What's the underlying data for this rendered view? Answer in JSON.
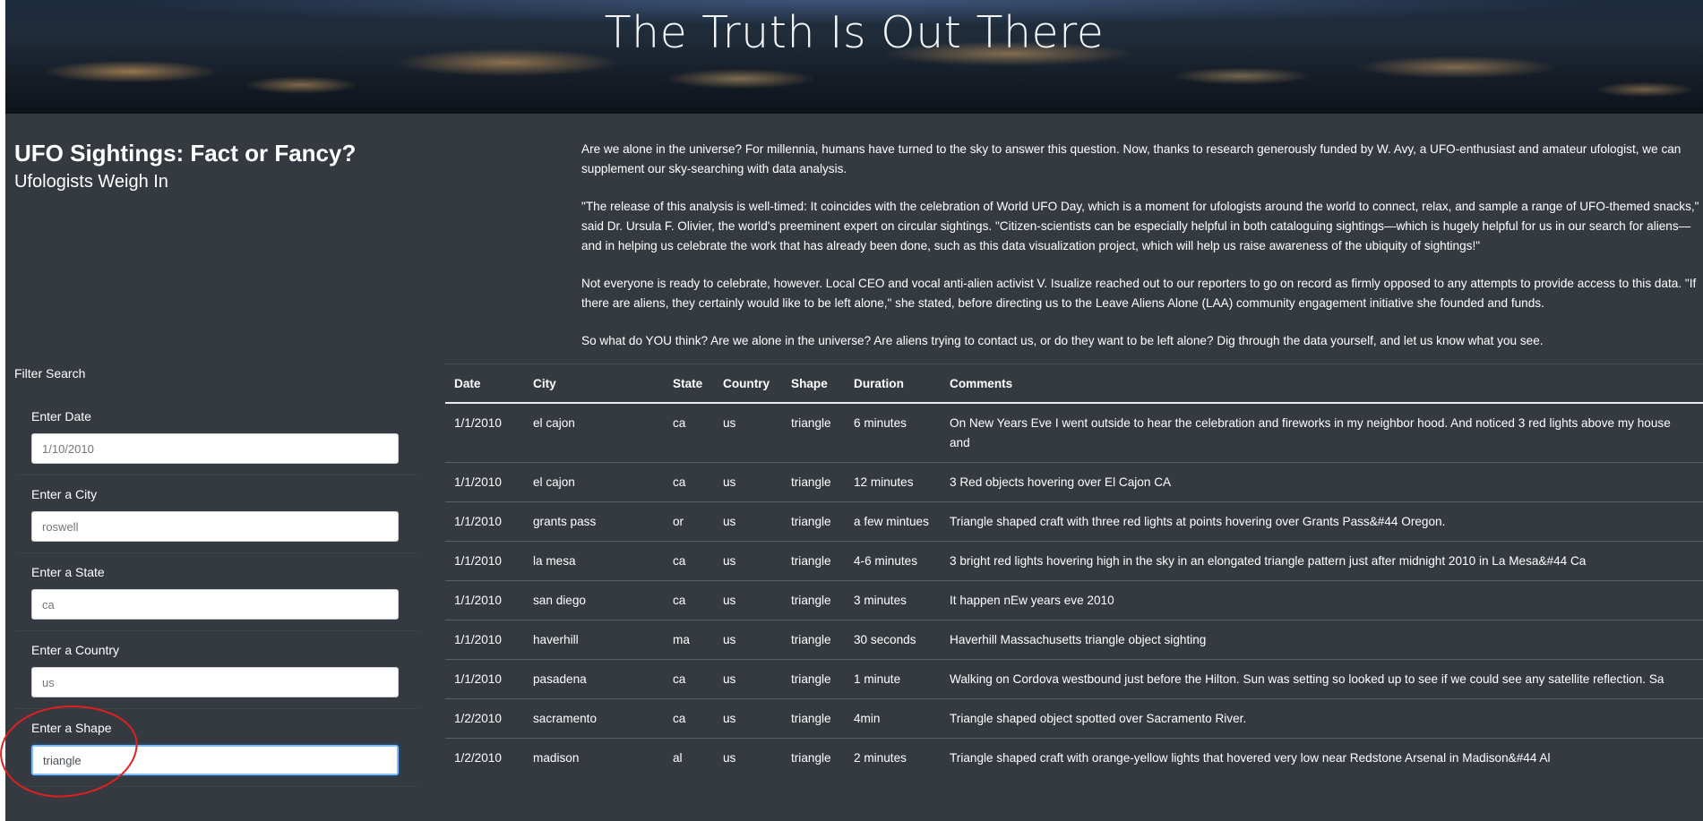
{
  "hero": {
    "title": "The Truth Is Out There"
  },
  "heading": {
    "title": "UFO Sightings: Fact or Fancy?",
    "subtitle": "Ufologists Weigh In"
  },
  "article": {
    "paragraphs": [
      "Are we alone in the universe? For millennia, humans have turned to the sky to answer this question. Now, thanks to research generously funded by W. Avy, a UFO-enthusiast and amateur ufologist, we can supplement our sky-searching with data analysis.",
      "\"The release of this analysis is well-timed: It coincides with the celebration of World UFO Day, which is a moment for ufologists around the world to connect, relax, and sample a range of UFO-themed snacks,\" said Dr. Ursula F. Olivier, the world's preeminent expert on circular sightings. \"Citizen-scientists can be especially helpful in both cataloguing sightings—which is hugely helpful for us in our search for aliens—and in helping us celebrate the work that has already been done, such as this data visualization project, which will help us raise awareness of the ubiquity of sightings!\"",
      "Not everyone is ready to celebrate, however. Local CEO and vocal anti-alien activist V. Isualize reached out to our reporters to go on record as firmly opposed to any attempts to provide access to this data. \"If there are aliens, they certainly would like to be left alone,\" she stated, before directing us to the Leave Aliens Alone (LAA) community engagement initiative she founded and funds.",
      "So what do YOU think? Are we alone in the universe? Are aliens trying to contact us, or do they want to be left alone? Dig through the data yourself, and let us know what you see."
    ]
  },
  "filter": {
    "label": "Filter Search",
    "fields": [
      {
        "label": "Enter Date",
        "placeholder": "1/10/2010",
        "value": ""
      },
      {
        "label": "Enter a City",
        "placeholder": "roswell",
        "value": ""
      },
      {
        "label": "Enter a State",
        "placeholder": "ca",
        "value": ""
      },
      {
        "label": "Enter a Country",
        "placeholder": "us",
        "value": ""
      },
      {
        "label": "Enter a Shape",
        "placeholder": "",
        "value": "triangle"
      }
    ]
  },
  "table": {
    "headers": [
      "Date",
      "City",
      "State",
      "Country",
      "Shape",
      "Duration",
      "Comments"
    ],
    "rows": [
      [
        "1/1/2010",
        "el cajon",
        "ca",
        "us",
        "triangle",
        "6 minutes",
        "On New Years Eve I went outside to hear the celebration and fireworks in my neighbor hood. And noticed 3 red lights above my house and"
      ],
      [
        "1/1/2010",
        "el cajon",
        "ca",
        "us",
        "triangle",
        "12 minutes",
        "3 Red objects hovering over El Cajon CA"
      ],
      [
        "1/1/2010",
        "grants pass",
        "or",
        "us",
        "triangle",
        "a few mintues",
        "Triangle shaped craft with three red lights at points hovering over Grants Pass&#44 Oregon."
      ],
      [
        "1/1/2010",
        "la mesa",
        "ca",
        "us",
        "triangle",
        "4-6 minutes",
        "3 bright red lights hovering high in the sky in an elongated triangle pattern just after midnight 2010 in La Mesa&#44 Ca"
      ],
      [
        "1/1/2010",
        "san diego",
        "ca",
        "us",
        "triangle",
        "3 minutes",
        "It happen nEw years eve 2010"
      ],
      [
        "1/1/2010",
        "haverhill",
        "ma",
        "us",
        "triangle",
        "30 seconds",
        "Haverhill Massachusetts triangle object sighting"
      ],
      [
        "1/1/2010",
        "pasadena",
        "ca",
        "us",
        "triangle",
        "1 minute",
        "Walking on Cordova westbound just before the Hilton. Sun was setting so looked up to see if we could see any satellite reflection. Sa"
      ],
      [
        "1/2/2010",
        "sacramento",
        "ca",
        "us",
        "triangle",
        "4min",
        "Triangle shaped object spotted over Sacramento River."
      ],
      [
        "1/2/2010",
        "madison",
        "al",
        "us",
        "triangle",
        "2 minutes",
        "Triangle shaped craft with orange-yellow lights that hovered very low near Redstone Arsenal in Madison&#44 Al"
      ]
    ]
  },
  "colors": {
    "background": "#343a40",
    "text": "#ffffff",
    "focus_border": "#80bdff",
    "annotation": "#e02020"
  }
}
